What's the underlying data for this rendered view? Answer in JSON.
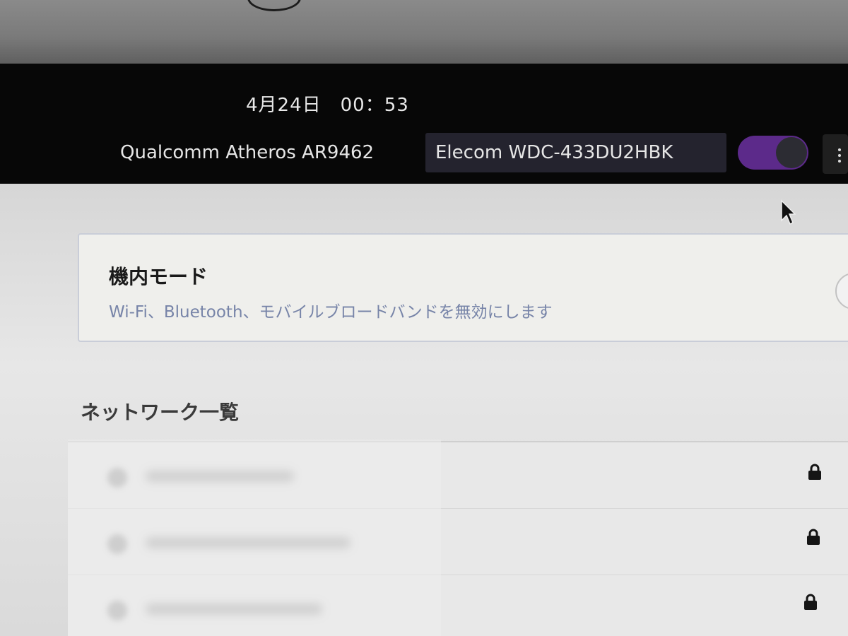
{
  "top_bar": {
    "clock": "4月24日　00：53",
    "device_tabs": [
      {
        "label": "Qualcomm Atheros AR9462",
        "selected": false
      },
      {
        "label": "Elecom WDC-433DU2HBK",
        "selected": true
      }
    ],
    "wifi_enabled": true,
    "accent_color": "#5c2a8a"
  },
  "airplane_mode": {
    "title": "機内モード",
    "description": "Wi-Fi、Bluetooth、モバイルブロードバンドを無効にします",
    "enabled": false
  },
  "networks": {
    "heading": "ネットワーク一覧",
    "items": [
      {
        "icon": "wifi-signal-icon",
        "secured": true
      },
      {
        "icon": "wifi-signal-icon",
        "secured": true
      },
      {
        "icon": "wifi-signal-icon",
        "secured": true
      }
    ]
  }
}
